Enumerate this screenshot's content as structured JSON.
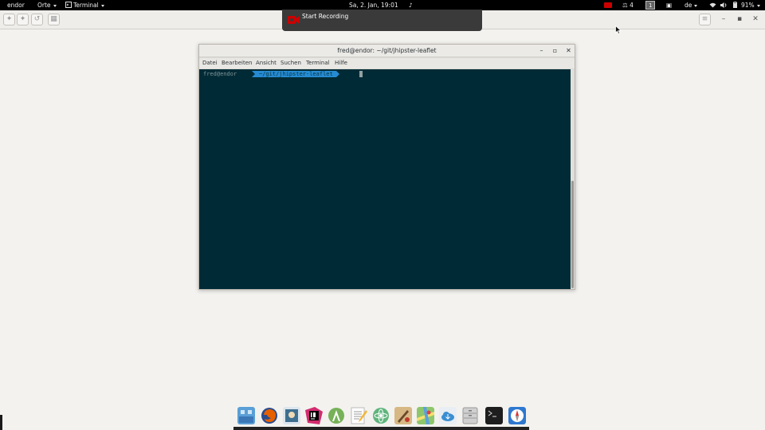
{
  "topbar": {
    "hostname": "endor",
    "places": "Orte",
    "app_menu": "Terminal",
    "datetime": "Sa,  2. Jan, 19:01",
    "workspace_count": "4",
    "workspace_index": "1",
    "keyboard": "de",
    "battery": "91%"
  },
  "notification": {
    "text": "Start Recording"
  },
  "terminal": {
    "title": "fred@endor: ~/git/jhipster-leaflet",
    "menu": [
      "Datei",
      "Bearbeiten",
      "Ansicht",
      "Suchen",
      "Terminal",
      "Hilfe"
    ],
    "prompt_user": "fred@endor",
    "prompt_dir": "~/git/jhipster-leaflet"
  },
  "colors": {
    "terminal_bg": "#002b36",
    "prompt_dir_bg": "#268bd2",
    "prompt_user_fg": "#839496",
    "topbar_bg": "#000000",
    "desktop_bg": "#f3f2ef"
  },
  "dock": {
    "icons": [
      "finder-icon",
      "firefox-icon",
      "image-viewer-icon",
      "intellij-icon",
      "android-studio-icon",
      "text-editor-icon",
      "atom-icon",
      "paint-icon",
      "maps-icon",
      "cloud-download-icon",
      "file-cabinet-icon",
      "terminal-icon",
      "safari-icon"
    ]
  }
}
